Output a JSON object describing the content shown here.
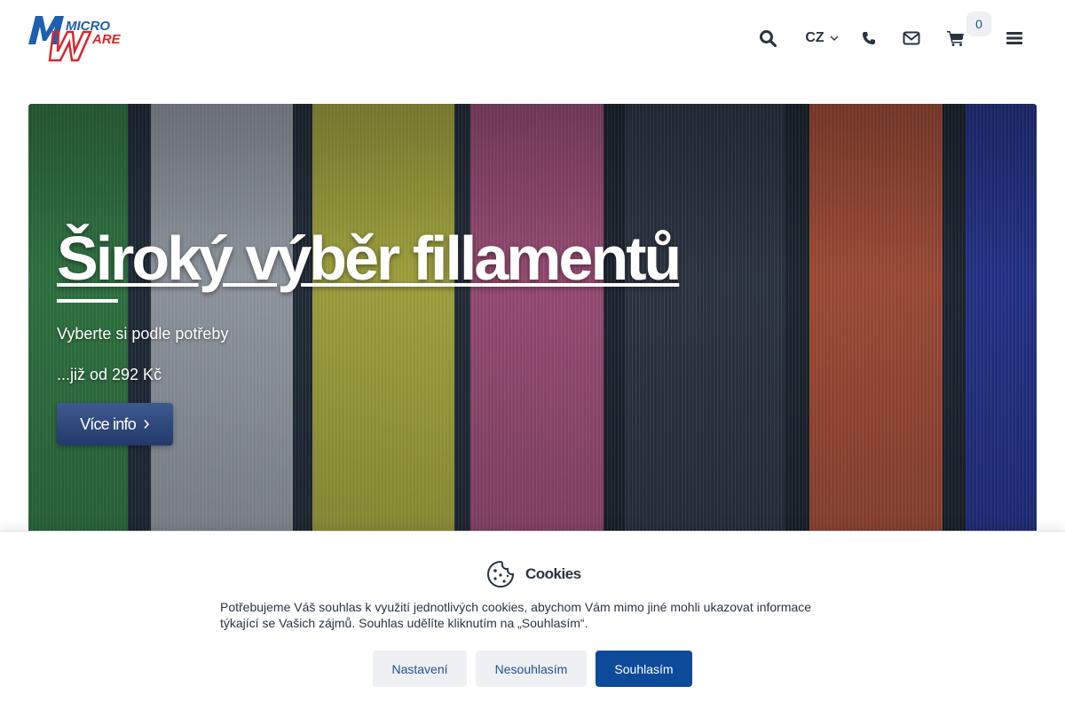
{
  "header": {
    "logo_alt": "MicroWare",
    "language": "CZ",
    "cart_count": "0"
  },
  "hero": {
    "title": "Široký výběr fillamentů",
    "subtitle": "Vyberte si podle potřeby",
    "price": "...již od 292 Kč",
    "button_label": "Více info",
    "spool_colors": [
      "#2f7a3f",
      "#9aa0a8",
      "#a7a83a",
      "#9a4a72",
      "#2a3240",
      "#a24a32",
      "#22308a"
    ]
  },
  "cookie": {
    "title": "Cookies",
    "text": "Potřebujeme Váš souhlas k využití jednotlivých cookies, abychom Vám mimo jiné mohli ukazovat informace týkající se Vašich zájmů. Souhlas udělíte kliknutím na „Souhlasím“.",
    "settings_label": "Nastavení",
    "decline_label": "Nesouhlasím",
    "accept_label": "Souhlasím"
  },
  "colors": {
    "primary": "#0d4a9a",
    "text": "#2a3340",
    "logo_blue": "#1e5fb0",
    "logo_red": "#d8262c"
  },
  "icons": [
    "search-icon",
    "chevron-down-icon",
    "phone-icon",
    "envelope-icon",
    "cart-icon",
    "menu-icon",
    "chevron-right-icon",
    "cookie-icon"
  ]
}
